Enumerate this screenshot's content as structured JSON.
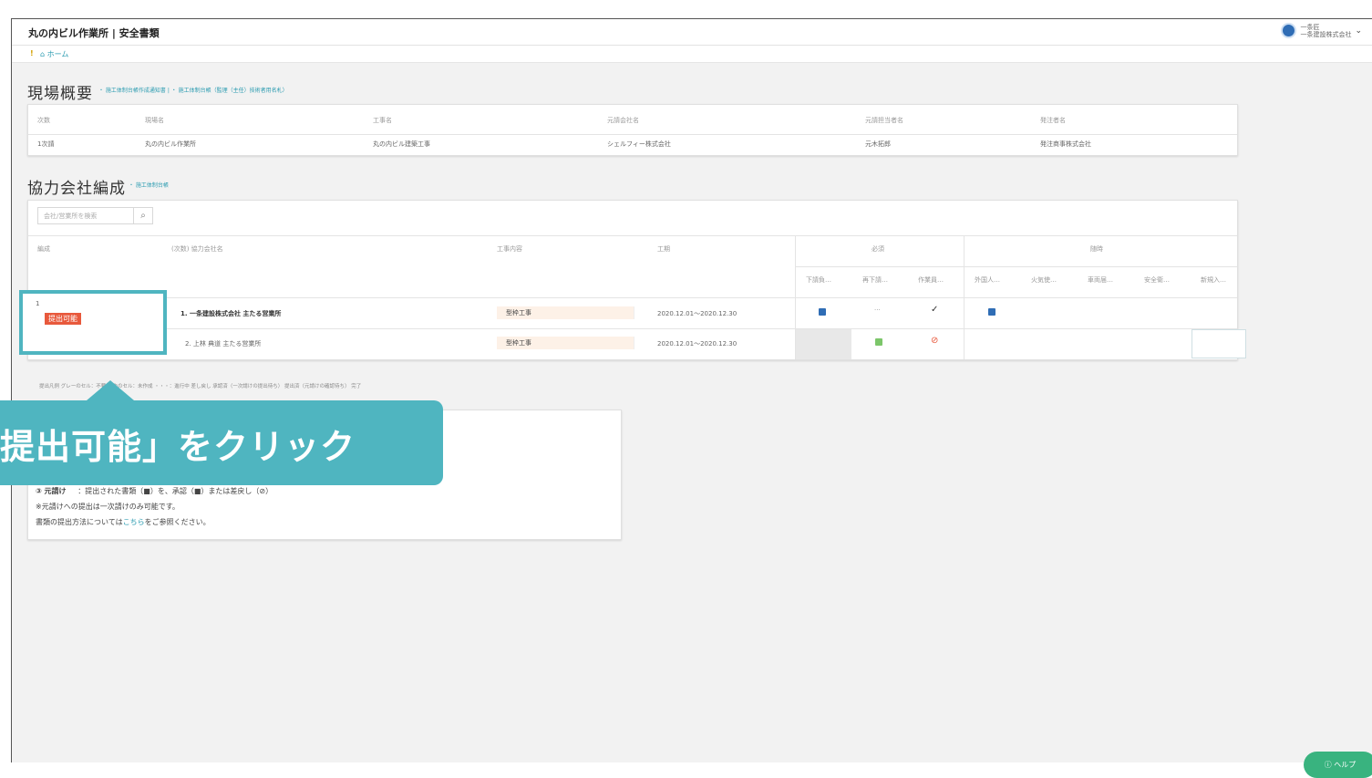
{
  "header": {
    "title": "丸の内ビル作業所 | 安全書類",
    "user_line1": "一条匠",
    "user_line2": "一条建設株式会社"
  },
  "breadcrumb": {
    "marker": "!",
    "home": "ホーム"
  },
  "overview": {
    "title": "現場概要",
    "links": "・ 施工体制台帳作成通知書 | ・ 施工体制台帳（監理（主任）技術者用名札）",
    "columns": [
      "次数",
      "現場名",
      "工事名",
      "元請会社名",
      "元請担当者名",
      "発注者名"
    ],
    "row": [
      "1次請",
      "丸の内ビル作業所",
      "丸の内ビル建築工事",
      "シェルフィー株式会社",
      "元木拓郎",
      "発注商事株式会社"
    ]
  },
  "partners": {
    "title": "協力会社編成",
    "link": "・ 施工体制台帳",
    "search_placeholder": "会社/営業所を検索",
    "columns": {
      "org": "編成",
      "name": "(次数) 協力会社名",
      "work": "工事内容",
      "period": "工期",
      "required": "必須",
      "optional": "随時"
    },
    "subcolumns": [
      "下請負…",
      "再下請…",
      "作業員…",
      "外国人…",
      "火気使…",
      "車両届…",
      "安全衛…",
      "新規入…"
    ],
    "rows": [
      {
        "num": "1",
        "badge": "提出可能",
        "name": "1. 一条建設株式会社 主たる営業所",
        "work": "型枠工事",
        "period": "2020.12.01〜2020.12.30"
      },
      {
        "num": "",
        "badge": "",
        "name": "2. 上林 典道 主たる営業所",
        "work": "型枠工事",
        "period": "2020.12.01〜2020.12.30"
      }
    ],
    "legend": "提出凡例  グレーのセル：不要   空白のセル：未作成   ・・・：進行中   差し戻し   承認済（一次請けの提出待ち）   提出済（元請けの確認待ち）   完了"
  },
  "callout": {
    "text": "提出可能」をクリック"
  },
  "info": {
    "line1_label": "③ 元請け",
    "line1_text": "：提出された書類（■）を、承認（■）または差戻し（⊘）",
    "line2": "※元請けへの提出は一次請けのみ可能です。",
    "line3_pre": "書類の提出方法については",
    "line3_link": "こちら",
    "line3_post": "をご参照ください。"
  },
  "help": {
    "label": "ヘルプ"
  },
  "colors": {
    "accent": "#4fb5c0",
    "badge": "#e8593c",
    "help": "#39b37f",
    "link": "#2a9bb0"
  }
}
